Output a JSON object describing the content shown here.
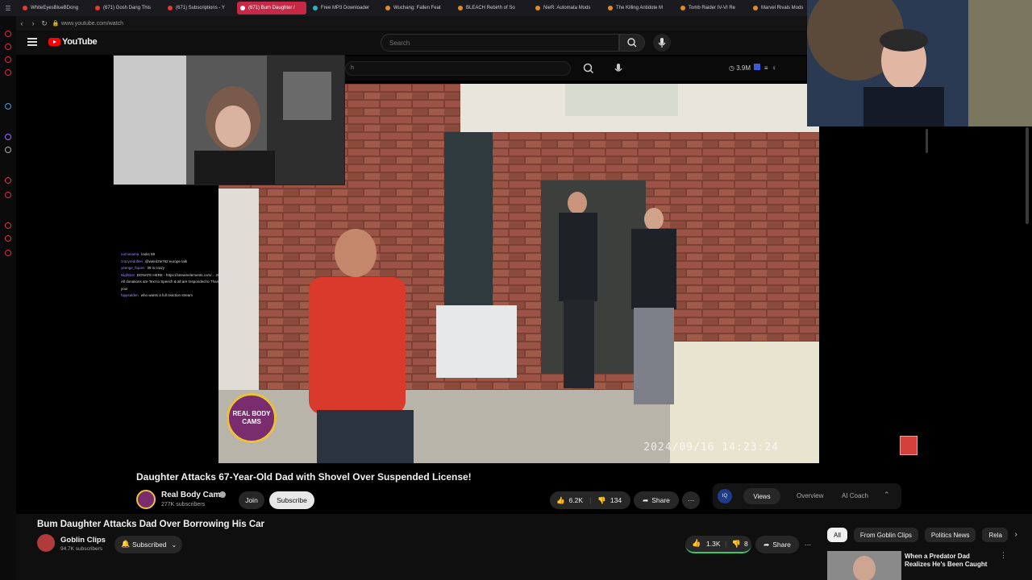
{
  "browser": {
    "tabs": [
      {
        "label": "WhiteEyesBlueBDong"
      },
      {
        "label": "(671) Gosh Dang This"
      },
      {
        "label": "(671) Subscriptions - Y"
      },
      {
        "label": "(671) Bum Daughter /"
      },
      {
        "label": "Free MP3 Downloader"
      },
      {
        "label": "Wuchang: Fallen Feat"
      },
      {
        "label": "BLEACH Rebirth of So"
      },
      {
        "label": "NieR: Automata Mods"
      },
      {
        "label": "The Killing Antidote M"
      },
      {
        "label": "Tomb Raider IV-VI Re"
      },
      {
        "label": "Marvel Rivals Mods"
      }
    ],
    "url": "www.youtube.com/watch"
  },
  "youtube": {
    "logo_text": "YouTube",
    "search_placeholder": "Search",
    "inner_search_text": "h",
    "inner_views": "3.9M"
  },
  "video": {
    "timestamp": "2024/09/16  14:23:24",
    "badge_text": "REAL BODY CAMS",
    "title": "Daughter Attacks 67-Year-Old Dad with Shovel Over Suspended License!",
    "channel": "Real Body Cams",
    "subscribers": "277K subscribers",
    "join_label": "Join",
    "subscribe_label": "Subscribe",
    "likes": "6.2K",
    "dislikes": "134",
    "share_label": "Share"
  },
  "tools": {
    "logo": "IQ",
    "tabs": [
      "Views",
      "Overview",
      "AI Coach"
    ]
  },
  "chat": [
    {
      "user": "nomimama",
      "text": "looks 59"
    },
    {
      "user": "crazyredoflen",
      "text": "@weirdzle762 europe talk"
    },
    {
      "user": "yeenge_fiquen",
      "text": "39 is crazy"
    },
    {
      "user": "Nightbot",
      "text": "DONATE HERE - https://streamelements.com/... 20/tip All donations are Text to Speech & all are responded to Thank you!"
    },
    {
      "user": "hippsalden",
      "text": "who wants a full reaction stream"
    }
  ],
  "outer": {
    "title": "Bum Daughter Attacks Dad Over Borrowing His Car",
    "channel": "Goblin Clips",
    "subscribers": "94.7K subscribers",
    "subscribed_label": "Subscribed",
    "likes": "1.3K",
    "dislikes": "8",
    "share_label": "Share",
    "chips": [
      "All",
      "From Goblin Clips",
      "Politics News",
      "Rela"
    ],
    "rec_title": "When a Predator Dad Realizes He's Been Caught"
  },
  "colors": {
    "accent": "#ff0000",
    "active_tab": "#c62845",
    "like_bar": "#2ecc71"
  }
}
